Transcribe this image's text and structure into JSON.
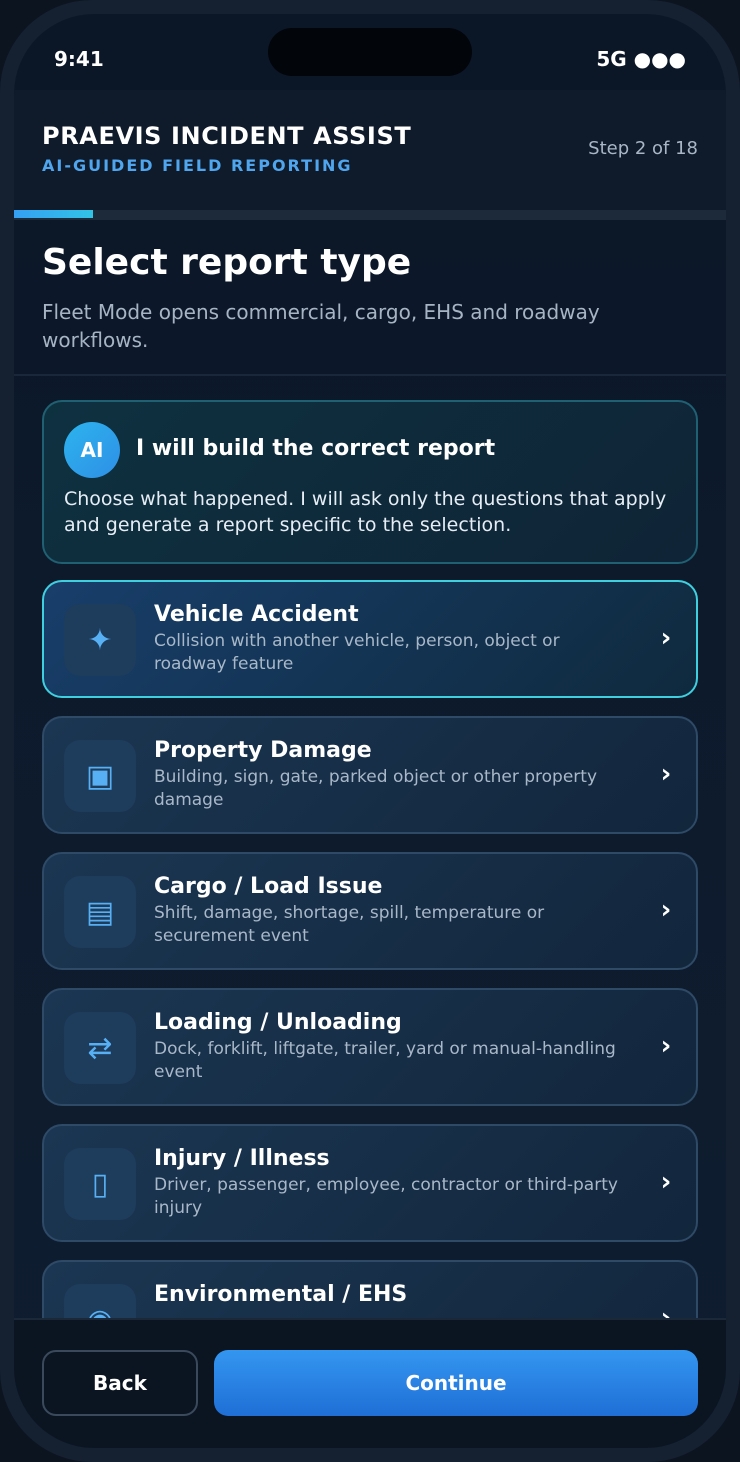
{
  "status_bar": {
    "time": "9:41",
    "network": "5G ●●●"
  },
  "header": {
    "title": "PRAEVIS INCIDENT ASSIST",
    "subtitle": "AI-GUIDED FIELD REPORTING",
    "step": "Step 2 of 18",
    "progress_fraction": 0.1111
  },
  "page": {
    "title": "Select report type",
    "description": "Fleet Mode opens commercial, cargo, EHS and roadway workflows."
  },
  "ai_card": {
    "badge": "AI",
    "title": "I will build the correct report",
    "text": "Choose what happened. I will ask only the questions that apply and generate a report specific to the selection."
  },
  "options": [
    {
      "title": "Vehicle Accident",
      "description": "Collision with another vehicle, person, object or roadway feature",
      "icon": "sparkle-icon",
      "glyph": "✦",
      "selected": true
    },
    {
      "title": "Property Damage",
      "description": "Building, sign, gate, parked object or other property damage",
      "icon": "square-icon",
      "glyph": "▣",
      "selected": false
    },
    {
      "title": "Cargo / Load Issue",
      "description": "Shift, damage, shortage, spill, temperature or securement event",
      "icon": "cargo-icon",
      "glyph": "▤",
      "selected": false
    },
    {
      "title": "Loading / Unloading",
      "description": "Dock, forklift, liftgate, trailer, yard or manual-handling event",
      "icon": "swap-arrows-icon",
      "glyph": "⇄",
      "selected": false
    },
    {
      "title": "Injury / Illness",
      "description": "Driver, passenger, employee, contractor or third-party injury",
      "icon": "injury-icon",
      "glyph": "▯",
      "selected": false
    },
    {
      "title": "Environmental / EHS",
      "description": "",
      "icon": "environment-icon",
      "glyph": "◉",
      "selected": false
    }
  ],
  "footer": {
    "back_label": "Back",
    "continue_label": "Continue"
  },
  "colors": {
    "accent": "#35a0f3",
    "selected_border": "#3fd0e0",
    "subtitle": "#4fa6ee"
  }
}
